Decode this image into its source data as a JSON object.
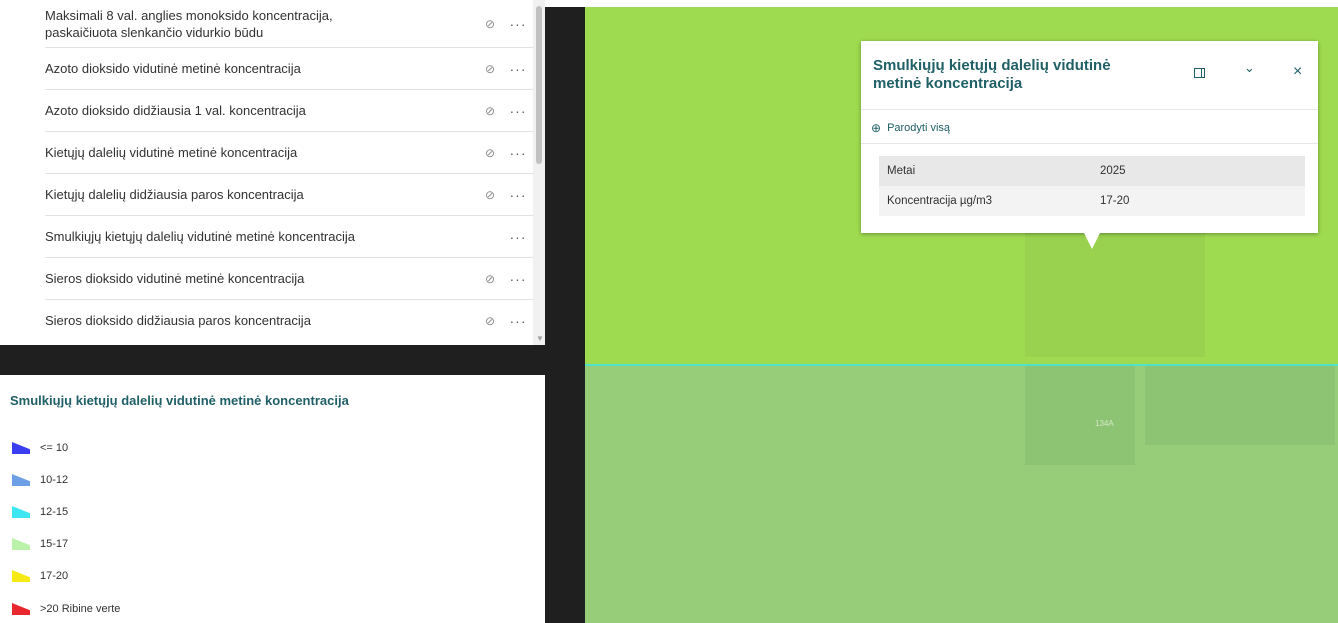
{
  "layers": [
    {
      "label_line1": "Maksimali 8 val. anglies monoksido koncentracija,",
      "label_line2": "paskaičiuota slenkančio vidurkio būdu",
      "hidden_icon": "eye-off-icon",
      "more": "···"
    },
    {
      "label": "Azoto dioksido vidutinė metinė koncentracija",
      "hidden_icon": "eye-off-icon",
      "more": "···"
    },
    {
      "label": "Azoto dioksido didžiausia 1 val. koncentracija",
      "hidden_icon": "eye-off-icon",
      "more": "···"
    },
    {
      "label": "Kietųjų dalelių vidutinė metinė koncentracija",
      "hidden_icon": "eye-off-icon",
      "more": "···"
    },
    {
      "label": "Kietųjų dalelių didžiausia paros koncentracija",
      "hidden_icon": "eye-off-icon",
      "more": "···"
    },
    {
      "label": "Smulkiųjų kietųjų dalelių vidutinė metinė koncentracija",
      "more": "···"
    },
    {
      "label": "Sieros dioksido vidutinė metinė koncentracija",
      "hidden_icon": "eye-off-icon",
      "more": "···"
    },
    {
      "label": "Sieros dioksido didžiausia paros koncentracija",
      "hidden_icon": "eye-off-icon",
      "more": "···"
    }
  ],
  "legend": {
    "title": "Smulkiųjų kietųjų dalelių vidutinė metinė koncentracija",
    "items": [
      {
        "label": "<= 10",
        "color": "#3a3df0"
      },
      {
        "label": "10-12",
        "color": "#6d9fe6"
      },
      {
        "label": "12-15",
        "color": "#3ee6f2"
      },
      {
        "label": "15-17",
        "color": "#b9f2a8"
      },
      {
        "label": "17-20",
        "color": "#f5ea14"
      },
      {
        "label": ">20 Ribine verte",
        "color": "#e8282e"
      }
    ]
  },
  "map": {
    "parcel_label": "134A"
  },
  "popup": {
    "title_line1": "Smulkiųjų kietųjų dalelių vidutinė",
    "title_line2": "metinė koncentracija",
    "zoom_label": "Parodyti visą",
    "rows": [
      {
        "key": "Metai",
        "value": "2025"
      },
      {
        "key": "Koncentracija µg/m3",
        "value": "17-20"
      }
    ],
    "buttons": {
      "dock": "dock-icon",
      "collapse": "⌄",
      "close": "×"
    }
  },
  "colors": {
    "accent": "#1f5f66",
    "map_green": "#9fdb50",
    "map_green_muted": "#97cd78",
    "boundary_line": "#4fe2c8"
  }
}
